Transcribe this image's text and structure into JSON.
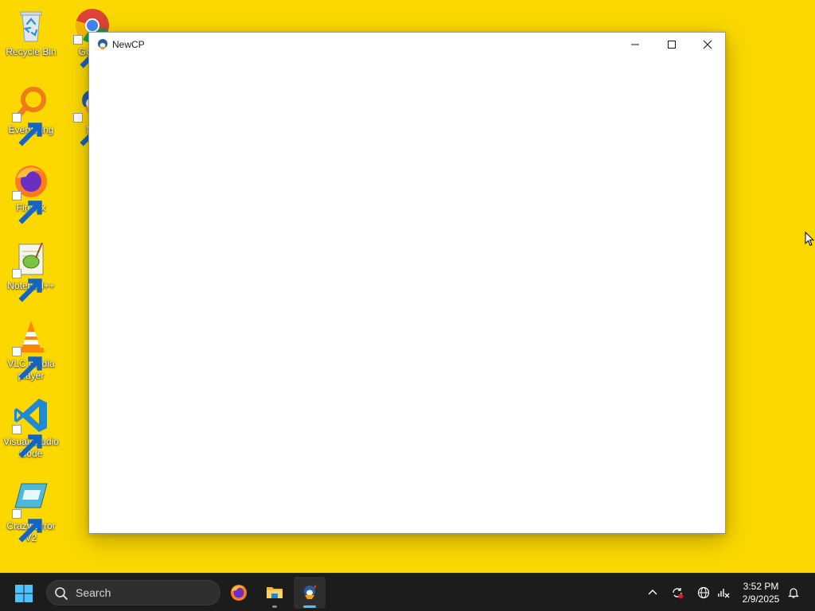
{
  "desktop": {
    "background_color": "#fcd800",
    "icons": [
      {
        "label": "Recycle Bin",
        "icon": "recycle-bin-icon"
      },
      {
        "label": "Everything",
        "icon": "everything-icon"
      },
      {
        "label": "Firefox",
        "icon": "firefox-icon"
      },
      {
        "label": "Notepad++",
        "icon": "notepad-plus-plus-icon"
      },
      {
        "label": "VLC media player",
        "icon": "vlc-icon"
      },
      {
        "label": "Visual Studio Code",
        "icon": "vscode-icon"
      },
      {
        "label": "Crazy Error V2",
        "icon": "crazy-error-icon"
      },
      {
        "label": "Go Ch",
        "icon": "chrome-icon"
      },
      {
        "label": "Ne",
        "icon": "newcp-icon"
      }
    ]
  },
  "window": {
    "title": "NewCP",
    "app_icon": "newcp-icon",
    "controls": {
      "minimize": "minimize-icon",
      "maximize": "maximize-icon",
      "close": "close-icon"
    }
  },
  "taskbar": {
    "start_icon": "windows-start-icon",
    "search": {
      "placeholder": "Search",
      "icon": "search-icon"
    },
    "pinned": [
      {
        "name": "Firefox",
        "icon": "firefox-icon"
      },
      {
        "name": "File Explorer",
        "icon": "folder-icon"
      },
      {
        "name": "NewCP",
        "icon": "newcp-icon",
        "active": true
      }
    ],
    "tray": {
      "icons": [
        "chevron-up-icon",
        "sync-icon",
        "globe-icon",
        "network-icon",
        "notification-bell-icon"
      ],
      "time": "3:52 PM",
      "date": "2/9/2025"
    },
    "accent_color": "#4cc2ff"
  }
}
